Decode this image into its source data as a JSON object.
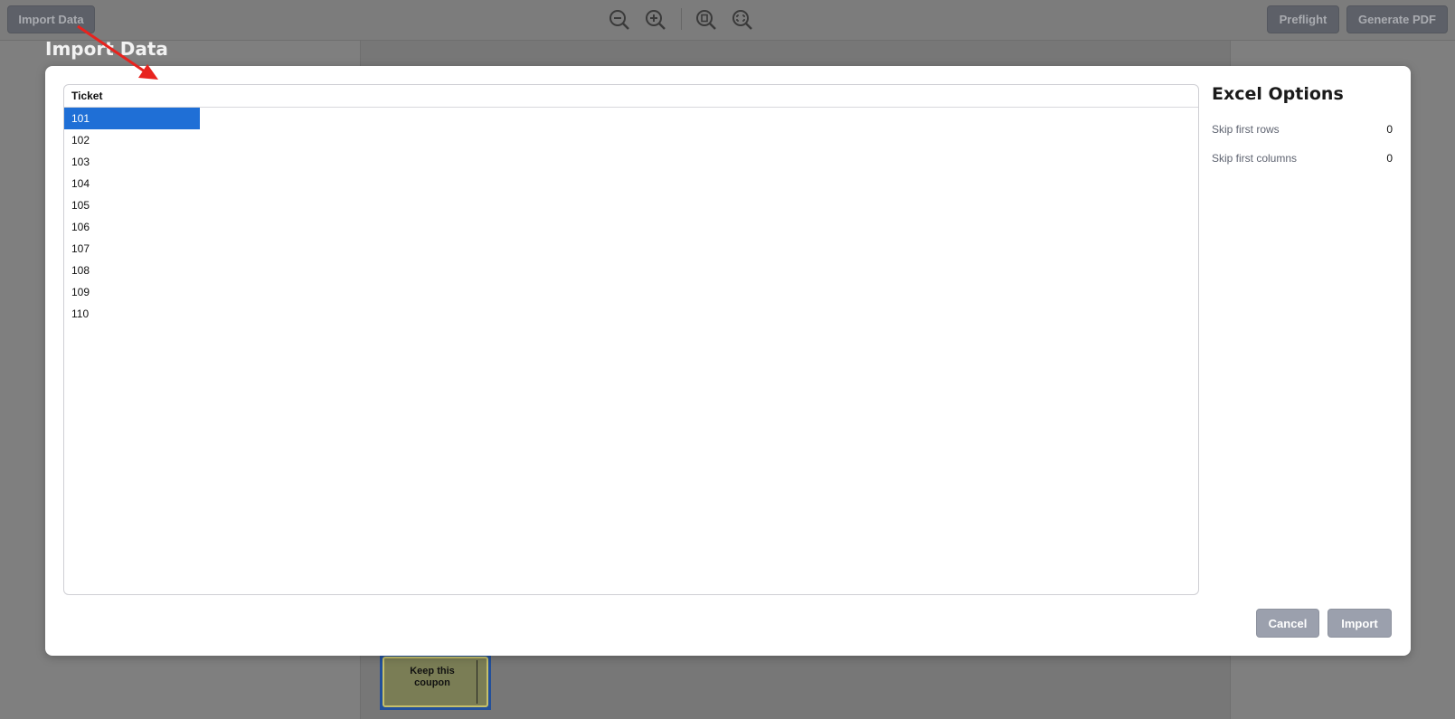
{
  "toolbar": {
    "import_data_label": "Import Data",
    "preflight_label": "Preflight",
    "generate_pdf_label": "Generate PDF"
  },
  "background": {
    "panel_title": "Import Data",
    "coupon_text": "Keep this coupon",
    "coupon_color": "#23509a"
  },
  "dialog": {
    "table": {
      "header": "Ticket",
      "rows": [
        "101",
        "102",
        "103",
        "104",
        "105",
        "106",
        "107",
        "108",
        "109",
        "110"
      ],
      "selected_row": "101",
      "selected_color": "#1f6fd6"
    },
    "options": {
      "title": "Excel Options",
      "skip_rows_label": "Skip first rows",
      "skip_rows_value": "0",
      "skip_cols_label": "Skip first columns",
      "skip_cols_value": "0"
    },
    "cancel_label": "Cancel",
    "import_label": "Import"
  },
  "annotation": {
    "arrow_color": "#e8231e"
  }
}
